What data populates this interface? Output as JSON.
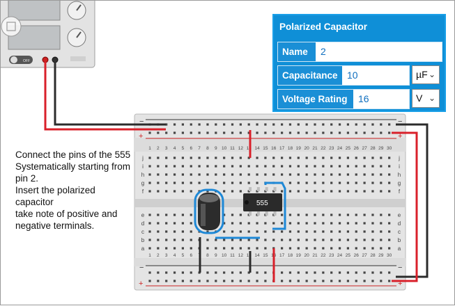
{
  "instructions": "Connect the pins of the 555\nSystematically starting from\npin 2.\nInsert the polarized capacitor\ntake note of positive and negative terminals.",
  "power_supply": {
    "switch_label": "OFF"
  },
  "inspector": {
    "title": "Polarized Capacitor",
    "name_label": "Name",
    "name_value": "2",
    "capacitance_label": "Capacitance",
    "capacitance_value": "10",
    "capacitance_unit": "µF",
    "voltage_label": "Voltage Rating",
    "voltage_value": "16",
    "voltage_unit": "V"
  },
  "breadboard": {
    "minus_label": "−",
    "plus_label": "+",
    "row_letters_top": [
      "j",
      "i",
      "h",
      "g",
      "f"
    ],
    "row_letters_bottom": [
      "e",
      "d",
      "c",
      "b",
      "a"
    ],
    "column_numbers": [
      "1",
      "2",
      "3",
      "4",
      "5",
      "6",
      "7",
      "8",
      "9",
      "10",
      "11",
      "12",
      "13",
      "14",
      "15",
      "16",
      "17",
      "18",
      "19",
      "20",
      "21",
      "22",
      "23",
      "24",
      "25",
      "26",
      "27",
      "28",
      "29",
      "30"
    ]
  },
  "chip": {
    "label": "555"
  },
  "colors": {
    "wire_red": "#d9202a",
    "wire_black": "#2b2b2b",
    "wire_blue": "#1e88d6",
    "panel_blue": "#0f8fd7"
  }
}
